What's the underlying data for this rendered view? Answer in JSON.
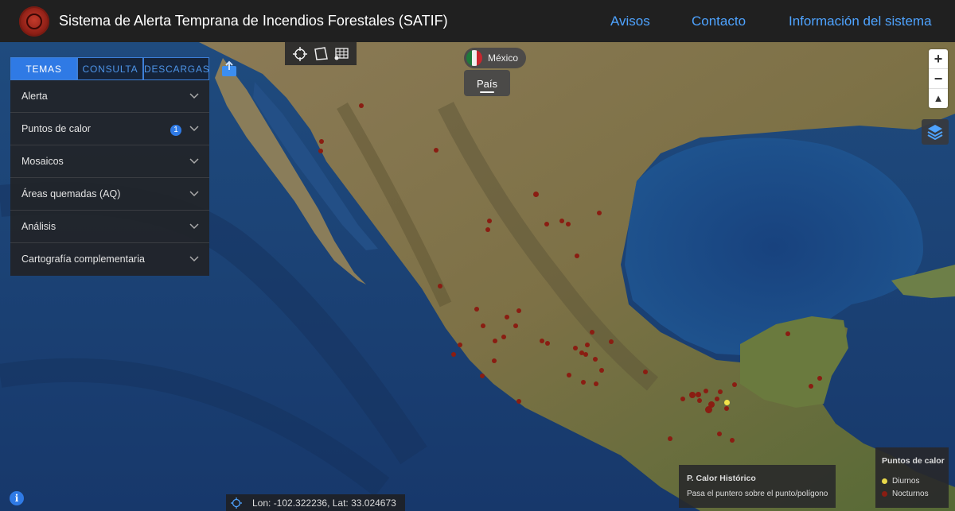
{
  "header": {
    "title": "Sistema de Alerta Temprana de Incendios Forestales (SATIF)",
    "nav": [
      "Avisos",
      "Contacto",
      "Información del sistema"
    ]
  },
  "panel": {
    "tabs": [
      "TEMAS",
      "CONSULTA",
      "DESCARGAS"
    ],
    "active_tab": "TEMAS",
    "items": [
      {
        "label": "Alerta"
      },
      {
        "label": "Puntos de calor",
        "badge": "1"
      },
      {
        "label": "Mosaicos"
      },
      {
        "label": "Áreas quemadas (AQ)"
      },
      {
        "label": "Análisis"
      },
      {
        "label": "Cartografía complementaria"
      }
    ]
  },
  "tools": [
    "crosshair-icon",
    "polygon-icon",
    "table-icon"
  ],
  "country": {
    "name": "México",
    "level": "País"
  },
  "zoom": {
    "in": "+",
    "out": "−",
    "reset": "▲"
  },
  "historic": {
    "title": "P. Calor Histórico",
    "hint": "Pasa el puntero sobre el punto/polígono"
  },
  "legend": {
    "title": "Puntos de calor",
    "items": [
      {
        "label": "Diurnos",
        "color": "#e8d84a"
      },
      {
        "label": "Nocturnos",
        "color": "#8a1d12"
      }
    ]
  },
  "coords": {
    "text": "Lon: -102.322236, Lat: 33.024673"
  },
  "colors": {
    "accent": "#2f7ae5",
    "link": "#4ea3ff",
    "fire_night": "#8a1d12",
    "fire_day": "#f2e34a"
  }
}
